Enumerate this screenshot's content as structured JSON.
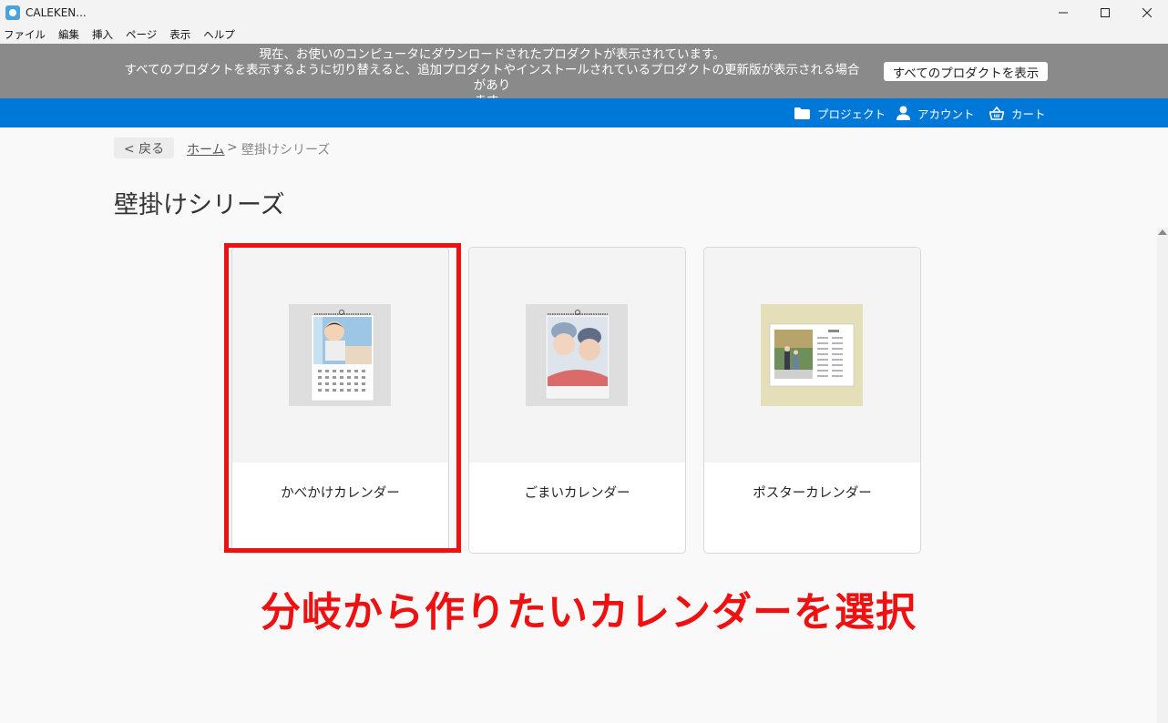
{
  "window": {
    "title": "CALEKEN...",
    "controls": [
      "minimize",
      "maximize",
      "close"
    ]
  },
  "menu": [
    "ファイル",
    "編集",
    "挿入",
    "ページ",
    "表示",
    "ヘルプ"
  ],
  "notice": {
    "line1": "現在、お使いのコンピュータにダウンロードされたプロダクトが表示されています。",
    "line2": "すべてのプロダクトを表示するように切り替えると、追加プロダクトやインストールされているプロダクトの更新版が表示される場合があり",
    "line3": "ます。",
    "button": "すべてのプロダクトを表示"
  },
  "nav": {
    "project": "プロジェクト",
    "account": "アカウント",
    "cart": "カート"
  },
  "breadcrumb": {
    "back": "< 戻る",
    "home": "ホーム",
    "separator": ">",
    "current": "壁掛けシリーズ"
  },
  "page_title": "壁掛けシリーズ",
  "products": [
    {
      "label": "かべかけカレンダー",
      "selected": true
    },
    {
      "label": "ごまいカレンダー",
      "selected": false
    },
    {
      "label": "ポスターカレンダー",
      "selected": false
    }
  ],
  "annotation": "分岐から作りたいカレンダーを選択",
  "colors": {
    "accent_blue": "#0078d7",
    "notice_gray": "#8a8a8a",
    "highlight_red": "#ee1111"
  }
}
